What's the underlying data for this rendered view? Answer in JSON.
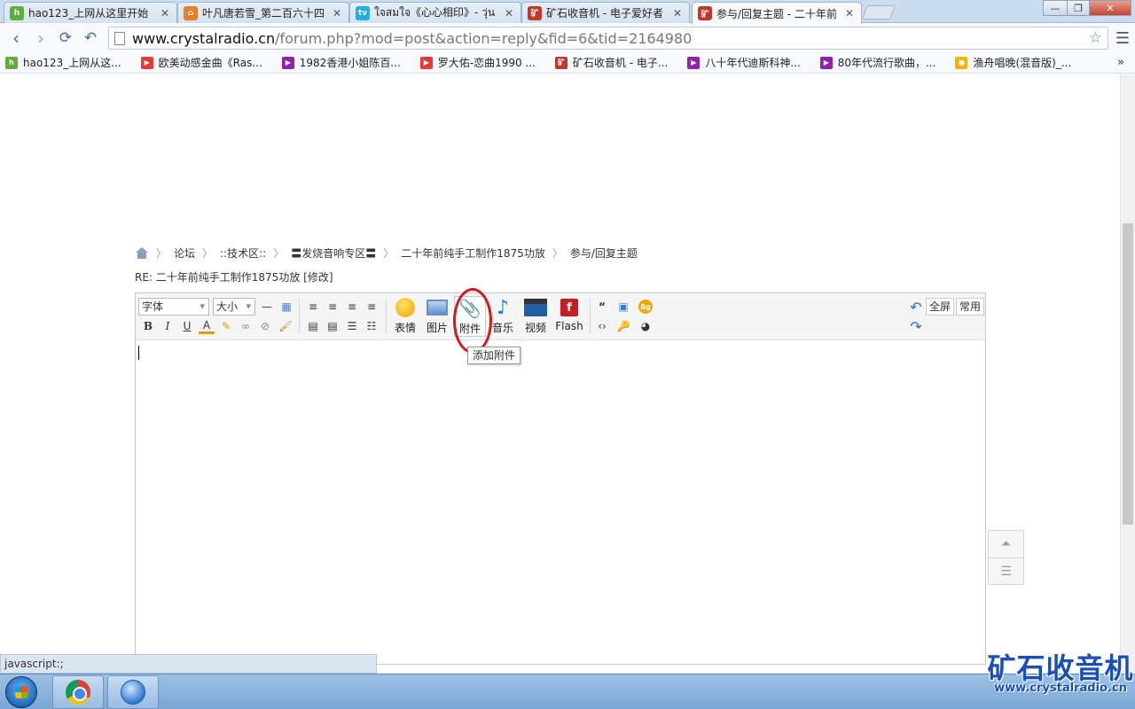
{
  "tabs": [
    {
      "title": "hao123_上网从这里开始",
      "icon": "hao123-icon",
      "color": "#4caf50"
    },
    {
      "title": "叶凡唐若雪_第二百六十四",
      "icon": "house-icon",
      "color": "#e67e22"
    },
    {
      "title": "ใจสมใจ《心心相印》- วุ่น",
      "icon": "bilibili-icon",
      "color": "#23ade5"
    },
    {
      "title": "矿石收音机 - 电子爱好者",
      "icon": "crystalradio-icon",
      "color": "#c0392b"
    },
    {
      "title": "参与/回复主题 - 二十年前",
      "icon": "crystalradio-icon",
      "color": "#c0392b"
    }
  ],
  "window": {
    "min": "—",
    "max": "❐",
    "close": "✕"
  },
  "address": {
    "host": "www.crystalradio.cn",
    "path": "/forum.php?mod=post&action=reply&fid=6&tid=2164980"
  },
  "bookmarks": [
    {
      "label": "hao123_上网从这...",
      "color": "#4caf50"
    },
    {
      "label": "欧美动感金曲《Ras...",
      "color": "#e53935"
    },
    {
      "label": "1982香港小姐陈百...",
      "color": "#8e24aa"
    },
    {
      "label": "罗大佑-恋曲1990 ...",
      "color": "#e53935"
    },
    {
      "label": "矿石收音机 - 电子...",
      "color": "#c0392b"
    },
    {
      "label": "八十年代迪斯科神...",
      "color": "#8e24aa"
    },
    {
      "label": "80年代流行歌曲，...",
      "color": "#8e24aa"
    },
    {
      "label": "渔舟唱晚(混音版)_...",
      "color": "#f4b400"
    }
  ],
  "breadcrumb": [
    "论坛",
    "::技术区::",
    "〓发烧音响专区〓",
    "二十年前纯手工制作1875功放",
    "参与/回复主题"
  ],
  "subject": "RE: 二十年前纯手工制作1875功放 [修改]",
  "editor": {
    "font_select": "字体",
    "size_select": "大小",
    "buttons": {
      "emoji": "表情",
      "image": "图片",
      "attach": "附件",
      "music": "音乐",
      "video": "视频",
      "flash": "Flash"
    },
    "fullscreen": "全屏",
    "common": "常用",
    "tooltip": "添加附件"
  },
  "status": "javascript:;",
  "watermark": {
    "name": "矿石收音机",
    "url": "www.crystalradio.cn"
  }
}
